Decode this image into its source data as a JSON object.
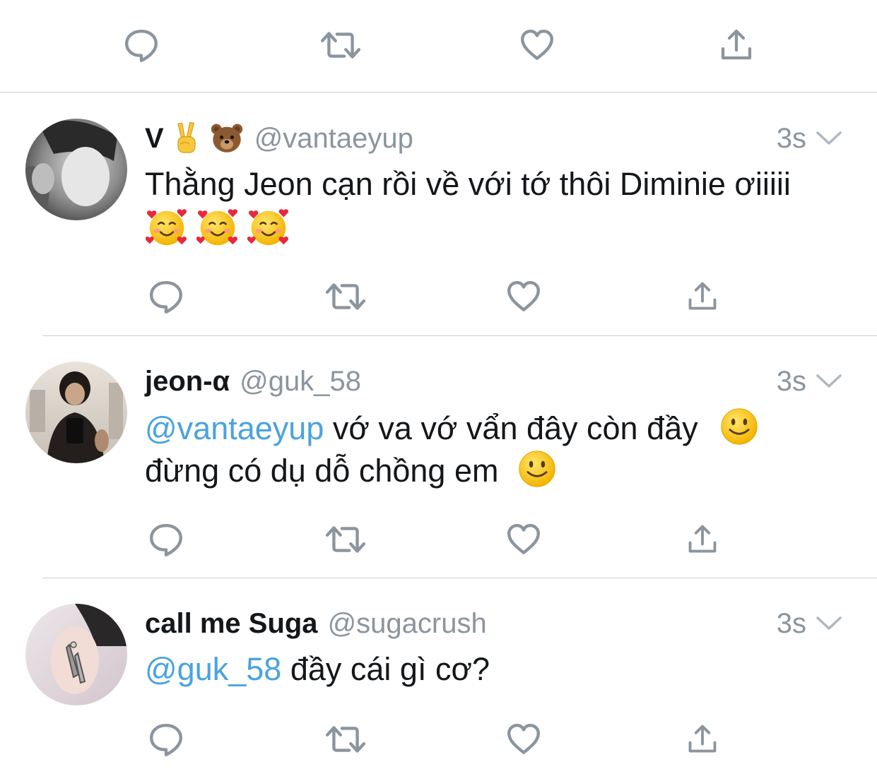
{
  "colors": {
    "icon_gray": "#8b959e",
    "mention_blue": "#4aa3df",
    "divider": "#c9ced3",
    "text": "#14171a"
  },
  "top_actions": [
    "reply-icon",
    "retweet-icon",
    "like-icon",
    "share-icon"
  ],
  "tweets": [
    {
      "display_name": "V",
      "name_emojis": [
        "victory-hand-emoji",
        "bear-emoji"
      ],
      "handle": "@vantaeyup",
      "timestamp": "3s",
      "text": "Thằng Jeon cạn rồi về với tớ thôi Diminie ơiiiii",
      "body_emojis": [
        "smiling-face-with-hearts-emoji",
        "smiling-face-with-hearts-emoji",
        "smiling-face-with-hearts-emoji"
      ]
    },
    {
      "display_name": "jeon-α",
      "handle": "@guk_58",
      "timestamp": "3s",
      "mention": "@vantaeyup",
      "text_line1": " vớ va vớ vẩn đây còn đầy",
      "text_line2": "đừng có dụ dỗ chồng em",
      "body_emojis": [
        "slightly-smiling-face-emoji",
        "slightly-smiling-face-emoji"
      ]
    },
    {
      "display_name": "call me Suga",
      "handle": "@sugacrush",
      "timestamp": "3s",
      "mention": "@guk_58",
      "text": " đầy cái gì cơ?"
    }
  ]
}
